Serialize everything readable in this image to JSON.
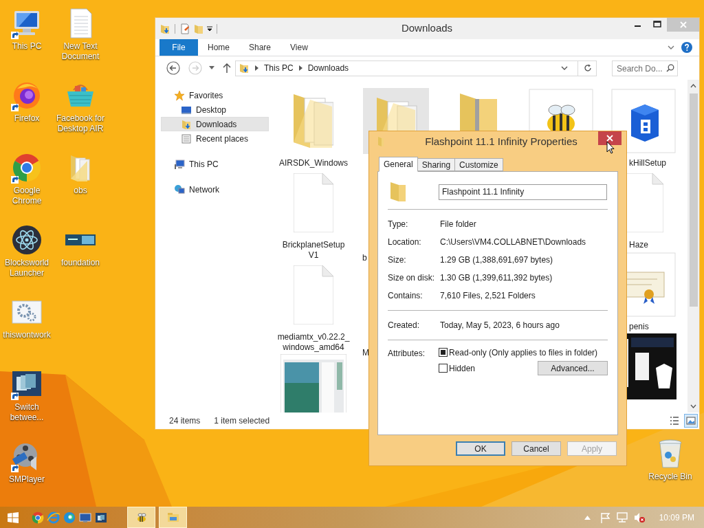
{
  "desktop_icons": [
    [
      {
        "label": "This PC",
        "kind": "pc",
        "shortcut": true
      },
      {
        "label": "Firefox",
        "kind": "firefox",
        "shortcut": true
      },
      {
        "label": "Google Chrome",
        "kind": "chrome",
        "shortcut": true
      },
      {
        "label": "Blocksworld Launcher",
        "kind": "electron",
        "shortcut": false
      },
      {
        "label": "thiswontwork",
        "kind": "gears",
        "shortcut": false
      },
      {
        "label": "Switch betwee...",
        "kind": "switch",
        "shortcut": true
      },
      {
        "label": "SMPlayer",
        "kind": "smplayer",
        "shortcut": true
      }
    ],
    [
      {
        "label": "New Text Document",
        "kind": "textdoc",
        "shortcut": false
      },
      {
        "label": "Facebook for Desktop AIR",
        "kind": "basket",
        "shortcut": false
      },
      {
        "label": "obs",
        "kind": "folder",
        "shortcut": false
      },
      {
        "label": "foundation",
        "kind": "foundation",
        "shortcut": false
      }
    ]
  ],
  "recycle_bin": {
    "label": "Recycle Bin"
  },
  "explorer": {
    "title": "Downloads",
    "ribbon_tabs": [
      {
        "label": "File",
        "kind": "file"
      },
      {
        "label": "Home",
        "kind": "tab"
      },
      {
        "label": "Share",
        "kind": "tab"
      },
      {
        "label": "View",
        "kind": "tab"
      }
    ],
    "forward": {
      "disabled": true
    },
    "breadcrumbs": [
      "This PC",
      "Downloads"
    ],
    "search": {
      "placeholder": "Search Do..."
    },
    "nav": [
      {
        "label": "Favorites",
        "kind": "star",
        "selected": false,
        "children": [
          {
            "label": "Desktop",
            "kind": "desktop",
            "selected": false
          },
          {
            "label": "Downloads",
            "kind": "downloads",
            "selected": true
          },
          {
            "label": "Recent places",
            "kind": "recent",
            "selected": false
          }
        ]
      },
      {
        "label": "This PC",
        "kind": "pc",
        "selected": false
      },
      {
        "label": "Network",
        "kind": "network",
        "selected": false
      }
    ],
    "file_columns": [
      [
        {
          "label": "AIRSDK_Windows",
          "kind": "folder",
          "selected": false
        },
        {
          "label": "BrickplanetSetup V1",
          "kind": "document",
          "selected": false
        },
        {
          "label": "mediamtx_v0.22.2_windows_amd64",
          "kind": "document",
          "selected": false
        },
        {
          "kind": "picture",
          "selected": false
        }
      ],
      [
        {
          "kind": "folder",
          "selected": true
        },
        {
          "label": "b",
          "selected": false
        },
        {
          "label": "M",
          "selected": false
        }
      ],
      [
        {
          "kind": "zip",
          "selected": false
        }
      ],
      [
        {
          "kind": "bee",
          "selected": false
        }
      ],
      [
        {
          "label": "kHillSetup",
          "kind": "block",
          "selected": false
        },
        {
          "label": "Haze",
          "kind": "document",
          "selected": false
        },
        {
          "label": "penis",
          "kind": "certificate",
          "selected": false
        },
        {
          "kind": "darkpicture",
          "selected": false
        }
      ]
    ],
    "status": {
      "count": "24 items",
      "selection": "1 item selected"
    },
    "views": [
      {
        "kind": "details",
        "selected": false
      },
      {
        "kind": "large",
        "selected": true
      }
    ]
  },
  "dialog": {
    "title": "Flashpoint 11.1 Infinity Properties",
    "tabs": [
      {
        "label": "General",
        "selected": true
      },
      {
        "label": "Sharing",
        "selected": false
      },
      {
        "label": "Customize",
        "selected": false
      }
    ],
    "name": "Flashpoint 11.1 Infinity",
    "groups": [
      [
        {
          "label": "Type:",
          "value": "File folder"
        },
        {
          "label": "Location:",
          "value": "C:\\Users\\VM4.COLLABNET\\Downloads"
        },
        {
          "label": "Size:",
          "value": "1.29 GB (1,388,691,697 bytes)"
        },
        {
          "label": "Size on disk:",
          "value": "1.30 GB (1,399,611,392 bytes)"
        },
        {
          "label": "Contains:",
          "value": "7,610 Files, 2,521 Folders"
        }
      ],
      [
        {
          "label": "Created:",
          "value": "Today, May 5, 2023, 6 hours ago"
        }
      ]
    ],
    "attributes": {
      "label": "Attributes:",
      "options": [
        {
          "label": "Read-only (Only applies to files in folder)",
          "checked": false,
          "indeterminate": true
        },
        {
          "label": "Hidden",
          "checked": false,
          "indeterminate": false
        }
      ],
      "advanced": "Advanced..."
    },
    "buttons": [
      {
        "label": "OK",
        "default": true,
        "disabled": false
      },
      {
        "label": "Cancel",
        "default": false,
        "disabled": false
      },
      {
        "label": "Apply",
        "default": false,
        "disabled": true
      }
    ]
  },
  "taskbar": {
    "pinned": [
      {
        "kind": "chrome"
      },
      {
        "kind": "ie"
      },
      {
        "kind": "edge"
      },
      {
        "kind": "monitor"
      },
      {
        "kind": "switch"
      }
    ],
    "running": [
      {
        "kind": "bee"
      },
      {
        "kind": "explorer"
      }
    ],
    "time": "10:09 PM"
  }
}
